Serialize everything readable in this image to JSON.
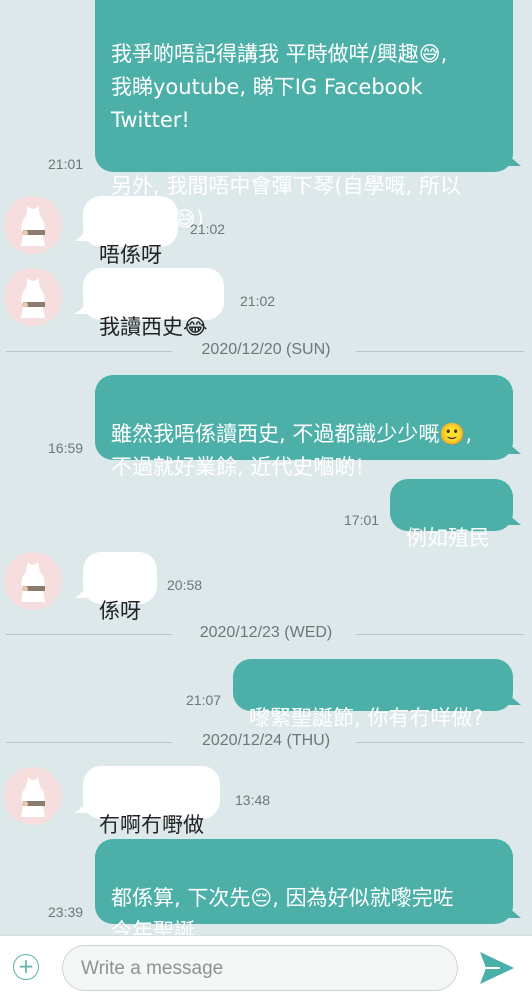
{
  "messages": [
    {
      "dir": "out",
      "text": "我爭啲唔記得講我 平時做咩/興趣😅,\n我睇youtube, 睇下IG Facebook Twitter!\n\n另外, 我間唔中會彈下琴(自學嘅, 所以\n麻麻地😅)",
      "time": "21:01"
    },
    {
      "dir": "in",
      "text": "唔係呀",
      "time": "21:02"
    },
    {
      "dir": "in",
      "text": "我讀西史😂",
      "time": "21:02"
    },
    {
      "dir": "out",
      "text": "雖然我唔係讀西史, 不過都識少少嘅🙂,\n不過就好業餘, 近代史嗰啲!",
      "time": "16:59"
    },
    {
      "dir": "out",
      "text": "例如殖民",
      "time": "17:01"
    },
    {
      "dir": "in",
      "text": "係呀",
      "time": "20:58"
    },
    {
      "dir": "out",
      "text": "嚟緊聖誕節, 你有冇咩做?",
      "time": "21:07"
    },
    {
      "dir": "in",
      "text": "冇啊冇嘢做",
      "time": "13:48"
    },
    {
      "dir": "out",
      "text": "都係算, 下次先😔, 因為好似就嚟完咗\n今年聖誕",
      "time": "23:39"
    }
  ],
  "date_separators": [
    "2020/12/20 (SUN)",
    "2020/12/23 (WED)",
    "2020/12/24 (THU)"
  ],
  "composer": {
    "placeholder": "Write a message"
  },
  "colors": {
    "outgoing_bubble": "#4cb0a8",
    "incoming_bubble": "#ffffff",
    "background": "#dde8ea",
    "accent": "#5fb3ac"
  },
  "icons": {
    "add": "plus-circle-icon",
    "send": "send-icon",
    "avatar": "dress-avatar-icon"
  }
}
